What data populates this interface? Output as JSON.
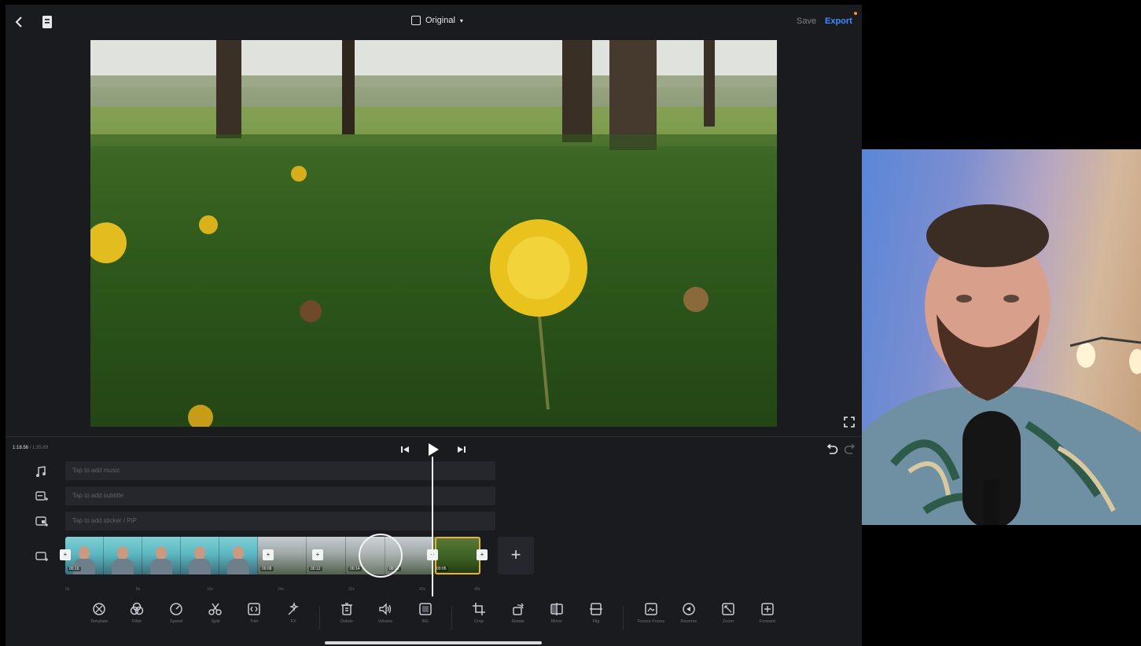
{
  "topbar": {
    "aspect_label": "Original",
    "save_label": "Save",
    "export_label": "Export"
  },
  "playback": {
    "current_time": "1:18.56",
    "separator": "/",
    "total_time": "1:35.69"
  },
  "tracks": {
    "music_placeholder": "Tap to add music",
    "subtitle_placeholder": "Tap to add subtitle",
    "sticker_placeholder": "Tap to add sticker / PiP"
  },
  "clips": [
    {
      "label": "00:16"
    },
    {
      "label": "00:06"
    },
    {
      "label": "00:12"
    },
    {
      "label": "00:14"
    },
    {
      "label": "00:12"
    },
    {
      "label": "00:05"
    }
  ],
  "ruler": [
    "0s",
    "8s",
    "16s",
    "24s",
    "32s",
    "40s",
    "48s"
  ],
  "toolbar": [
    {
      "label": "Template",
      "icon": "template-icon"
    },
    {
      "label": "Filter",
      "icon": "filter-icon"
    },
    {
      "label": "Speed",
      "icon": "speed-icon"
    },
    {
      "label": "Split",
      "icon": "scissors-icon"
    },
    {
      "label": "Trim",
      "icon": "trim-icon"
    },
    {
      "label": "FX",
      "icon": "fx-icon"
    },
    {
      "label": "Delete",
      "icon": "trash-icon"
    },
    {
      "label": "Volume",
      "icon": "volume-icon"
    },
    {
      "label": "BG",
      "icon": "background-icon"
    },
    {
      "label": "Crop",
      "icon": "crop-icon"
    },
    {
      "label": "Rotate",
      "icon": "rotate-icon"
    },
    {
      "label": "Mirror",
      "icon": "mirror-icon"
    },
    {
      "label": "Flip",
      "icon": "flip-icon"
    },
    {
      "label": "Freeze Frame",
      "icon": "freeze-frame-icon"
    },
    {
      "label": "Reverse",
      "icon": "reverse-icon"
    },
    {
      "label": "Zoom",
      "icon": "zoom-icon"
    },
    {
      "label": "Forward",
      "icon": "forward-icon"
    }
  ],
  "colors": {
    "accent": "#3f8cff",
    "selected_clip": "#e7b23a",
    "background": "#1a1b1f"
  }
}
